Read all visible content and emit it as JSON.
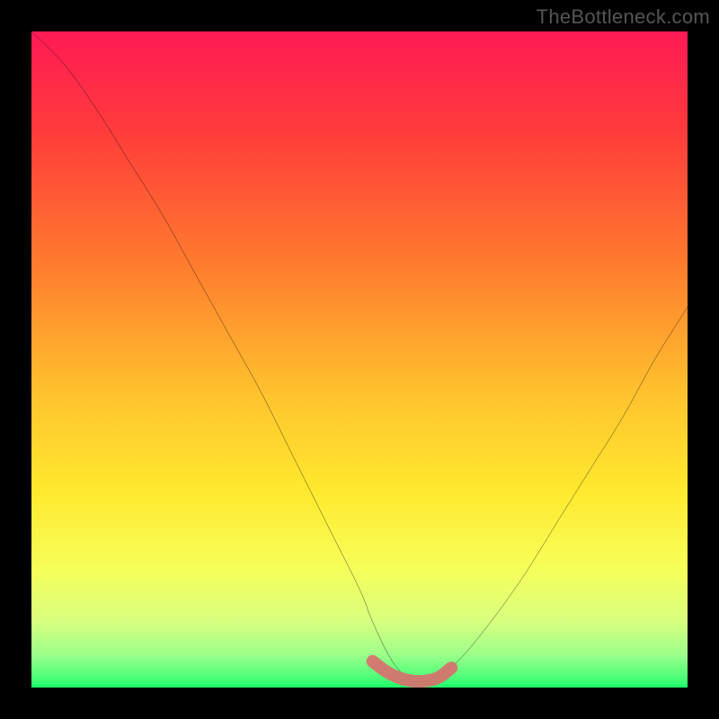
{
  "watermark": "TheBottleneck.com",
  "chart_data": {
    "type": "line",
    "title": "",
    "xlabel": "",
    "ylabel": "",
    "xlim": [
      0,
      100
    ],
    "ylim": [
      0,
      100
    ],
    "grid": false,
    "legend": false,
    "description": "Bottleneck curve over a red-to-green vertical gradient. V-shaped black curve dipping to ~0 around x≈58, with a small salmon-colored marker segment at the bottom of the valley. Gradient: top red → orange → yellow → yellow-green → bright green stripe at the very bottom.",
    "series": [
      {
        "name": "bottleneck-curve",
        "color": "#000000",
        "x": [
          0,
          5,
          10,
          15,
          20,
          25,
          30,
          35,
          40,
          45,
          50,
          52,
          55,
          58,
          60,
          62,
          65,
          70,
          75,
          80,
          85,
          90,
          95,
          100
        ],
        "values": [
          100,
          95,
          88,
          80,
          72,
          63,
          54,
          45,
          35,
          25,
          15,
          10,
          4,
          1,
          1,
          2,
          4,
          10,
          17,
          25,
          33,
          41,
          50,
          58
        ]
      }
    ],
    "marker": {
      "name": "valley-highlight",
      "color": "#d9706f",
      "x": [
        52,
        54,
        56,
        58,
        60,
        62,
        64
      ],
      "values": [
        4,
        2.5,
        1.5,
        1,
        1,
        1.5,
        3
      ]
    },
    "gradient_stops": [
      {
        "pos": 0.0,
        "color": "#ff1a55"
      },
      {
        "pos": 0.15,
        "color": "#ff3b3b"
      },
      {
        "pos": 0.35,
        "color": "#ff7a2e"
      },
      {
        "pos": 0.55,
        "color": "#ffc22e"
      },
      {
        "pos": 0.7,
        "color": "#ffe92e"
      },
      {
        "pos": 0.82,
        "color": "#f6ff5a"
      },
      {
        "pos": 0.9,
        "color": "#d8ff80"
      },
      {
        "pos": 0.95,
        "color": "#9bff8a"
      },
      {
        "pos": 0.985,
        "color": "#4dff78"
      },
      {
        "pos": 1.0,
        "color": "#1aff68"
      }
    ]
  }
}
